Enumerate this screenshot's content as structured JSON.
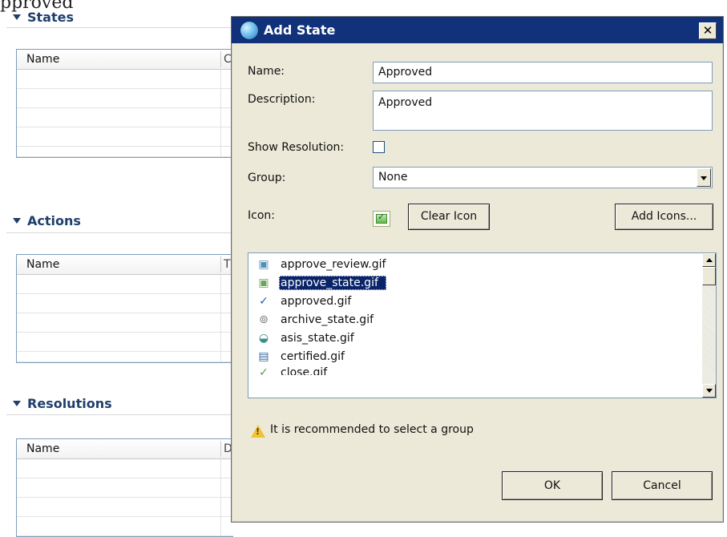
{
  "background": {
    "cut_text": "pproved",
    "sections": [
      {
        "title": "States",
        "column": "Name",
        "column2_stub": "C"
      },
      {
        "title": "Actions",
        "column": "Name",
        "column2_stub": "T"
      },
      {
        "title": "Resolutions",
        "column": "Name",
        "column2_stub": "D"
      }
    ]
  },
  "dialog": {
    "title": "Add State",
    "close_glyph": "✕",
    "name_label": "Name:",
    "name_value": "Approved",
    "description_label": "Description:",
    "description_value": "Approved",
    "show_resolution_label": "Show Resolution:",
    "show_resolution_checked": false,
    "group_label": "Group:",
    "group_value": "None",
    "icon_label": "Icon:",
    "clear_icon_label": "Clear Icon",
    "add_icons_label": "Add Icons...",
    "icon_list": [
      {
        "icon": "review-icon",
        "glyph": "▣",
        "color": "#4f8fb8",
        "label": "approve_review.gif",
        "selected": false
      },
      {
        "icon": "state-icon",
        "glyph": "▣",
        "color": "#6aa55a",
        "label": "approve_state.gif",
        "selected": true
      },
      {
        "icon": "checkmark-icon",
        "glyph": "✓",
        "color": "#1c5fb3",
        "label": "approved.gif",
        "selected": false
      },
      {
        "icon": "archive-icon",
        "glyph": "⊚",
        "color": "#777777",
        "label": "archive_state.gif",
        "selected": false
      },
      {
        "icon": "asis-icon",
        "glyph": "◒",
        "color": "#3d8f8a",
        "label": "asis_state.gif",
        "selected": false
      },
      {
        "icon": "certified-icon",
        "glyph": "▤",
        "color": "#3568a8",
        "label": "certified.gif",
        "selected": false
      },
      {
        "icon": "close-icon",
        "glyph": "✓",
        "color": "#5a9c3b",
        "label": "close.gif",
        "selected": false
      }
    ],
    "warning_text": "It is recommended to select a group",
    "ok_label": "OK",
    "cancel_label": "Cancel",
    "colors": {
      "titlebar": "#11327a",
      "dialog_bg": "#ece9d8",
      "selection": "#0a246a",
      "section_header": "#1f3f6b"
    }
  }
}
